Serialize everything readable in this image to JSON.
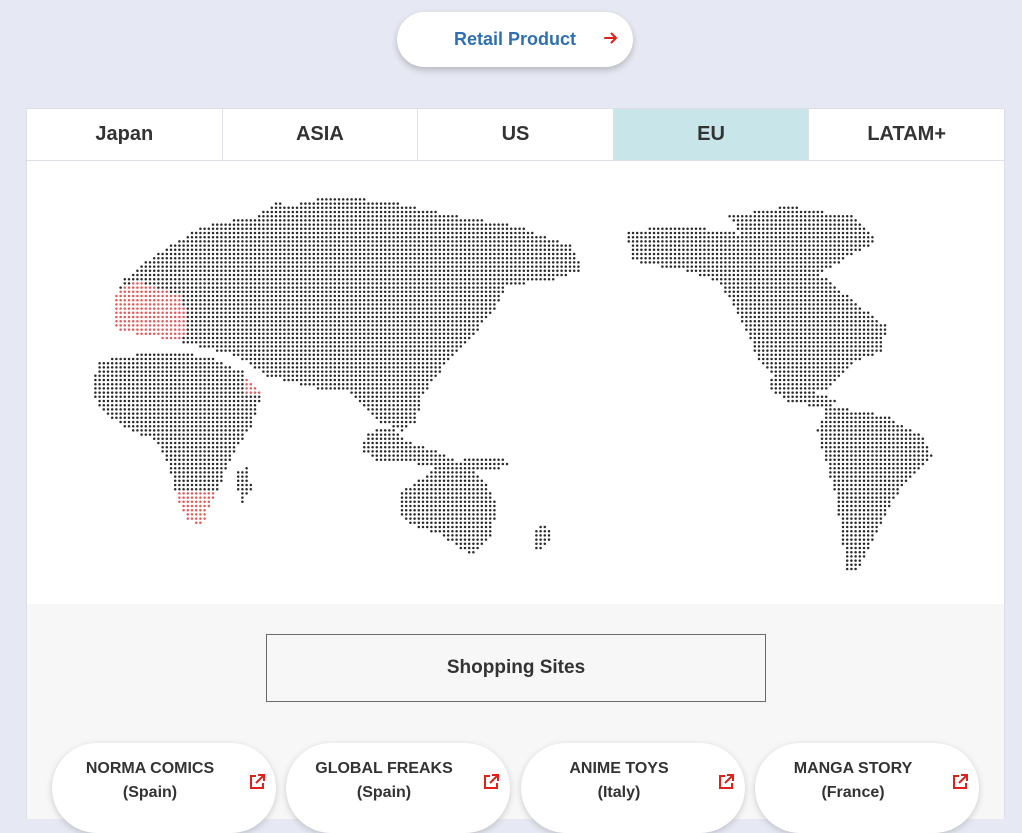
{
  "retail_button": {
    "label": "Retail Product",
    "icon": "arrow-right-icon",
    "icon_color": "#e0201b"
  },
  "tabs": [
    {
      "label": "Japan",
      "active": false
    },
    {
      "label": "ASIA",
      "active": false
    },
    {
      "label": "US",
      "active": false
    },
    {
      "label": "EU",
      "active": true
    },
    {
      "label": "LATAM+",
      "active": false
    }
  ],
  "map": {
    "dot_color": "#2a2a2a",
    "highlight_color": "#e35a5a",
    "highlighted_regions": [
      "Western Europe",
      "Middle East",
      "Southern Africa"
    ]
  },
  "shopping": {
    "title": "Shopping Sites",
    "sites": [
      {
        "name": "NORMA COMICS",
        "country": "(Spain)"
      },
      {
        "name": "GLOBAL FREAKS",
        "country": "(Spain)"
      },
      {
        "name": "ANIME TOYS",
        "country": "(Italy)"
      },
      {
        "name": "MANGA STORY",
        "country": "(France)"
      }
    ],
    "link_icon": "external-link-icon",
    "link_icon_color": "#e0201b"
  }
}
